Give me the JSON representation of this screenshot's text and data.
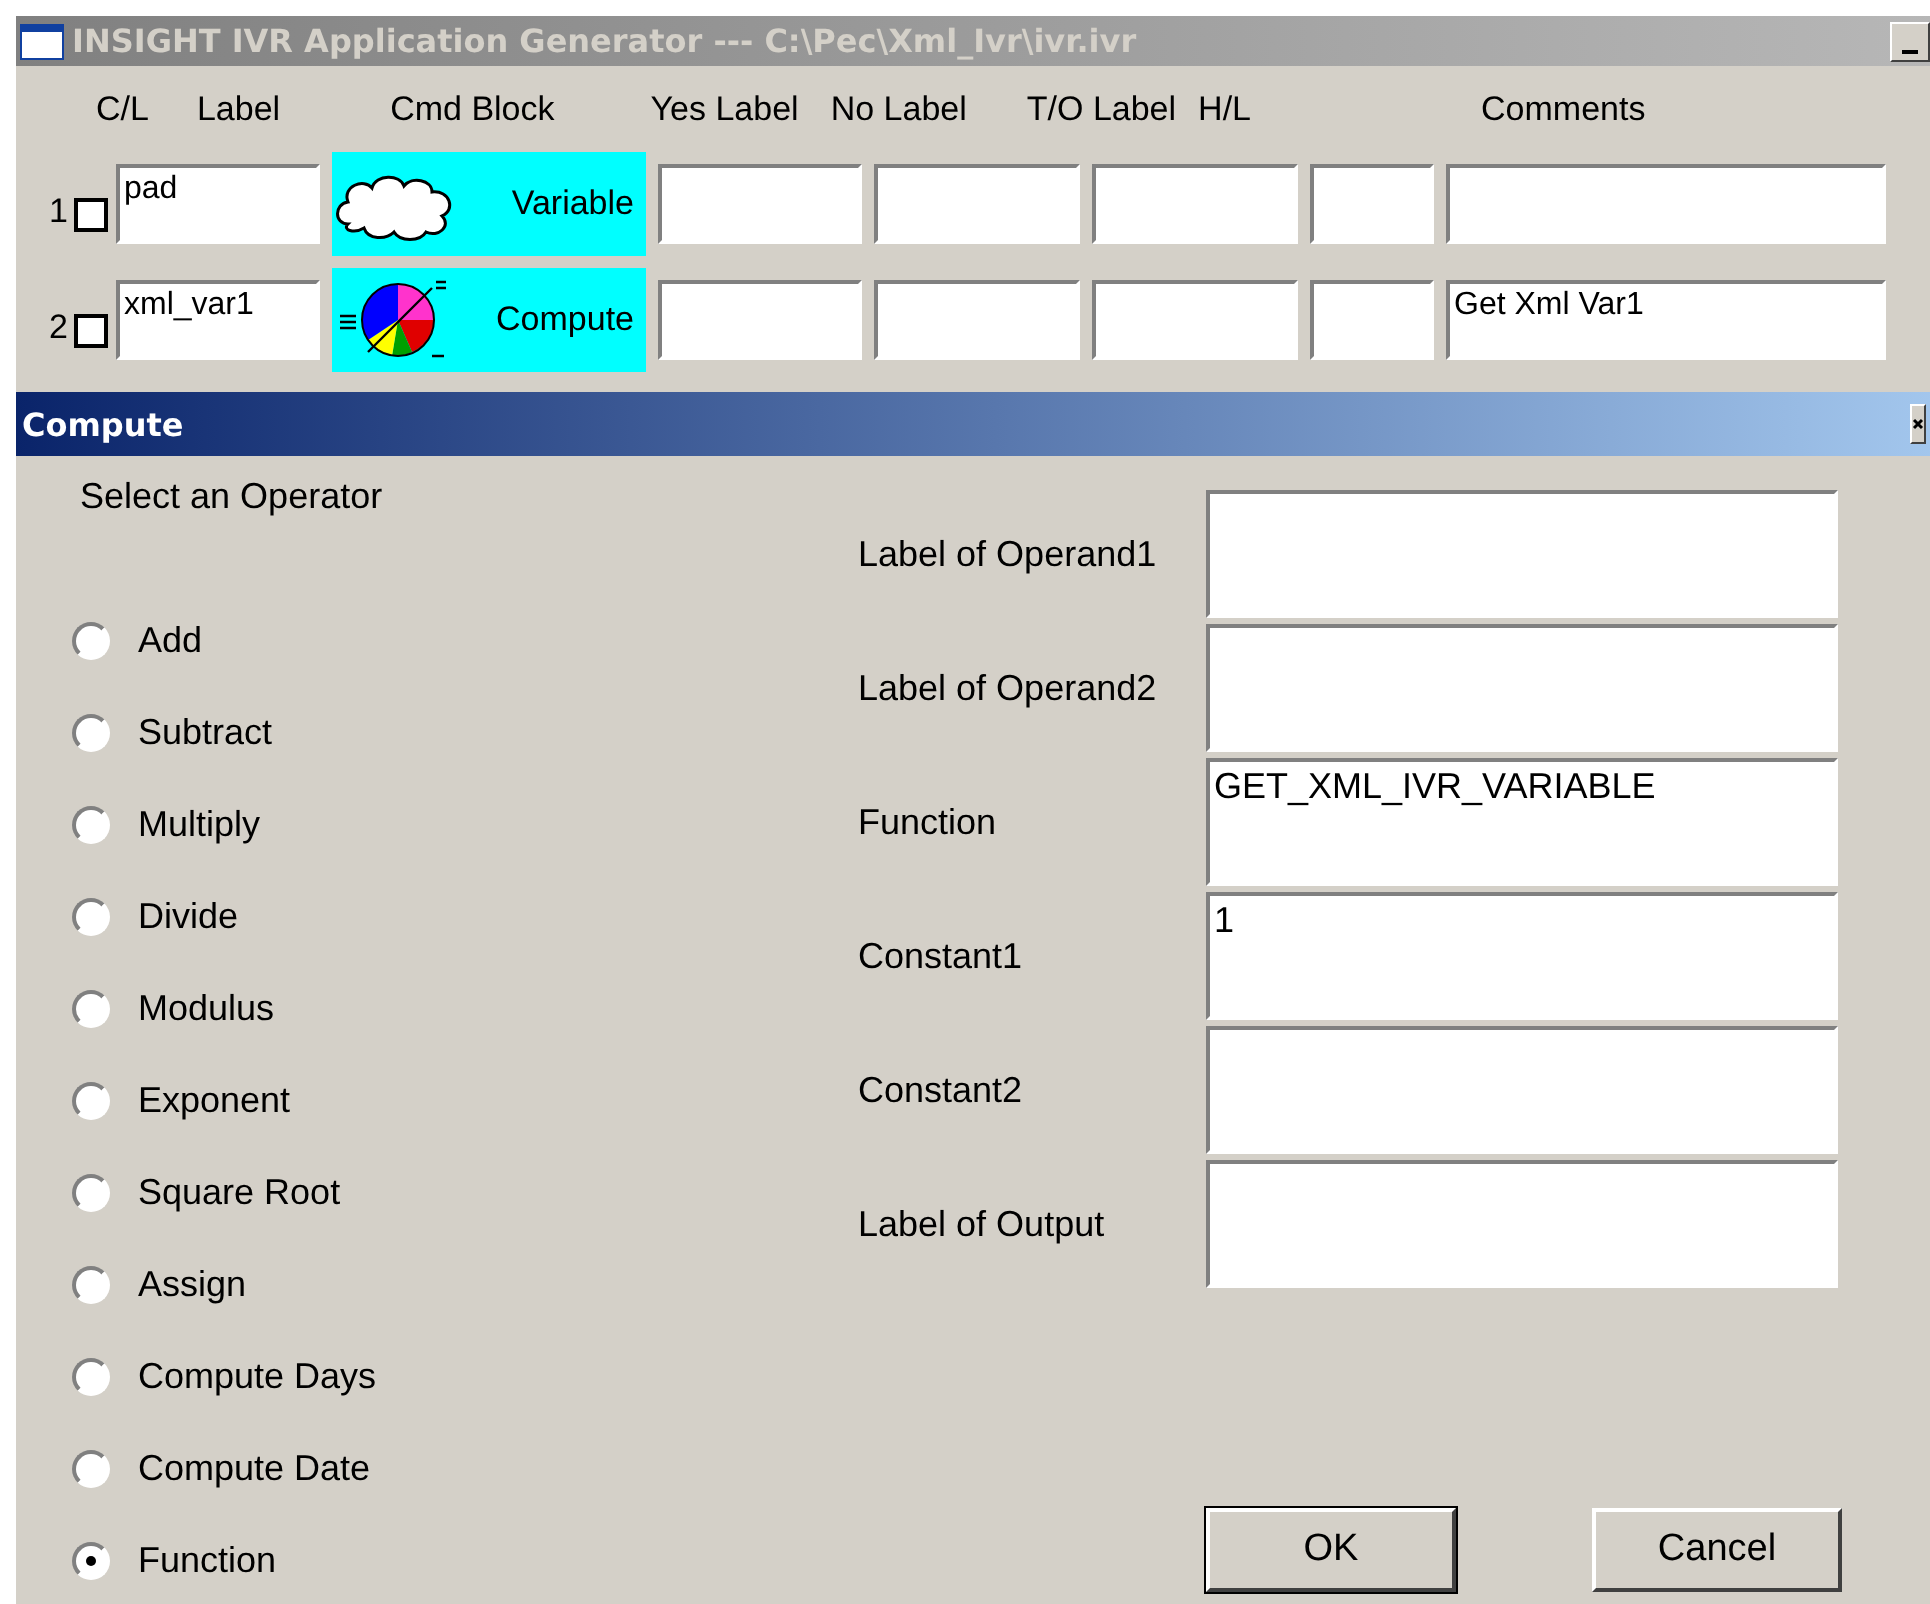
{
  "window": {
    "title": "INSIGHT IVR Application Generator --- C:\\Pec\\Xml_Ivr\\ivr.ivr"
  },
  "table": {
    "columns": [
      "C/L",
      "Label",
      "Cmd Block",
      "Yes Label",
      "No Label",
      "T/O Label",
      "H/L",
      "Comments"
    ],
    "rows": [
      {
        "number": "1",
        "checked": false,
        "label": "pad",
        "cmd_block": {
          "kind": "variable",
          "label": "Variable"
        }
      },
      {
        "number": "2",
        "checked": false,
        "label": "xml_var1",
        "cmd_block": {
          "kind": "compute",
          "label": "Compute"
        },
        "comments": "Get Xml Var1"
      }
    ]
  },
  "dialog": {
    "title": "Compute",
    "group_label": "Select an Operator",
    "operators": [
      {
        "label": "Add",
        "selected": false
      },
      {
        "label": "Subtract",
        "selected": false
      },
      {
        "label": "Multiply",
        "selected": false
      },
      {
        "label": "Divide",
        "selected": false
      },
      {
        "label": "Modulus",
        "selected": false
      },
      {
        "label": "Exponent",
        "selected": false
      },
      {
        "label": "Square Root",
        "selected": false
      },
      {
        "label": "Assign",
        "selected": false
      },
      {
        "label": "Compute Days",
        "selected": false
      },
      {
        "label": "Compute Date",
        "selected": false
      },
      {
        "label": "Function",
        "selected": true
      }
    ],
    "fields": [
      {
        "label": "Label of Operand1"
      },
      {
        "label": "Label of Operand2"
      },
      {
        "label": "Function",
        "value": "GET_XML_IVR_VARIABLE"
      },
      {
        "label": "Constant1",
        "value": "1"
      },
      {
        "label": "Constant2"
      },
      {
        "label": "Label of Output"
      }
    ],
    "buttons": [
      "OK",
      "Cancel"
    ]
  }
}
